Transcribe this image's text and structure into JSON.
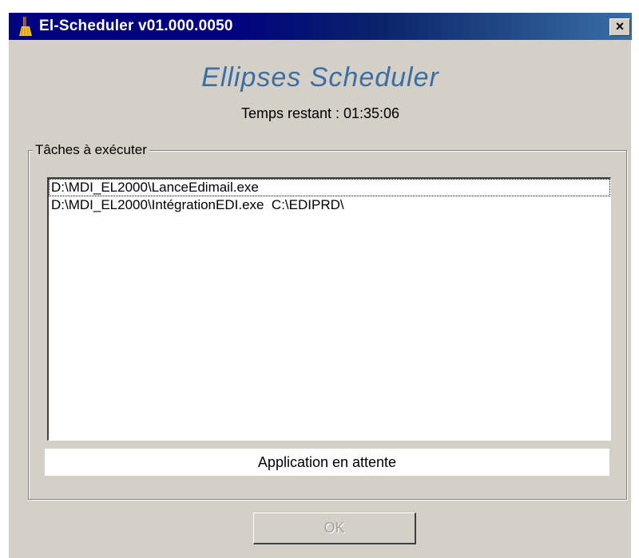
{
  "window": {
    "title": "El-Scheduler v01.000.0050",
    "close_label": "×",
    "icon": "broom-icon"
  },
  "header": {
    "app_title": "Ellipses Scheduler",
    "remaining": "Temps restant : 01:35:06"
  },
  "tasks": {
    "group_label": "Tâches à exécuter",
    "items": [
      "D:\\MDI_EL2000\\LanceEdimail.exe",
      "D:\\MDI_EL2000\\IntégrationEDI.exe  C:\\EDIPRD\\"
    ]
  },
  "status": "Application en attente",
  "buttons": {
    "ok_label": "OK"
  },
  "colors": {
    "titlebar": "#000080",
    "app_title": "#3a6ea5",
    "face": "#d4d0c8"
  }
}
